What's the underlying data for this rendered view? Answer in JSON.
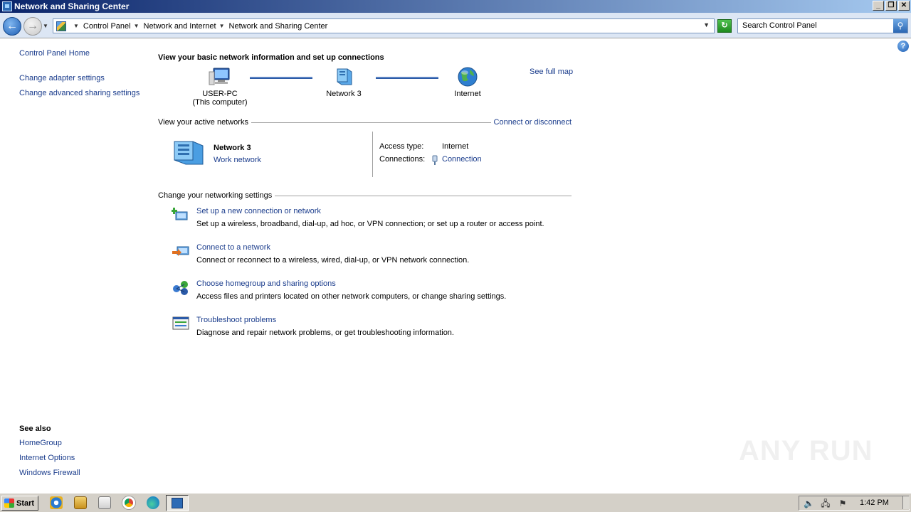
{
  "window": {
    "title": "Network and Sharing Center",
    "controls": {
      "minimize": "_",
      "maximize": "❐",
      "close": "✕"
    }
  },
  "address": {
    "breadcrumbs": [
      "Control Panel",
      "Network and Internet",
      "Network and Sharing Center"
    ],
    "search_placeholder": "Search Control Panel"
  },
  "sidebar": {
    "home": "Control Panel Home",
    "links": [
      "Change adapter settings",
      "Change advanced sharing settings"
    ],
    "see_also_heading": "See also",
    "see_also": [
      "HomeGroup",
      "Internet Options",
      "Windows Firewall"
    ]
  },
  "main": {
    "title": "View your basic network information and set up connections",
    "see_full_map": "See full map",
    "map": {
      "computer_name": "USER-PC",
      "computer_sub": "(This computer)",
      "network": "Network  3",
      "internet": "Internet"
    },
    "active_networks": {
      "heading": "View your active networks",
      "action": "Connect or disconnect",
      "network_name": "Network  3",
      "network_type": "Work network",
      "access_type_label": "Access type:",
      "access_type_value": "Internet",
      "connections_label": "Connections:",
      "connections_value": "Connection"
    },
    "settings": {
      "heading": "Change your networking settings",
      "tasks": [
        {
          "title": "Set up a new connection or network",
          "desc": "Set up a wireless, broadband, dial-up, ad hoc, or VPN connection; or set up a router or access point.",
          "icon": "new-connection-icon"
        },
        {
          "title": "Connect to a network",
          "desc": "Connect or reconnect to a wireless, wired, dial-up, or VPN network connection.",
          "icon": "connect-network-icon"
        },
        {
          "title": "Choose homegroup and sharing options",
          "desc": "Access files and printers located on other network computers, or change sharing settings.",
          "icon": "homegroup-icon"
        },
        {
          "title": "Troubleshoot problems",
          "desc": "Diagnose and repair network problems, or get troubleshooting information.",
          "icon": "troubleshoot-icon"
        }
      ]
    }
  },
  "watermark": "ANY RUN",
  "taskbar": {
    "start": "Start",
    "clock": "1:42 PM"
  }
}
